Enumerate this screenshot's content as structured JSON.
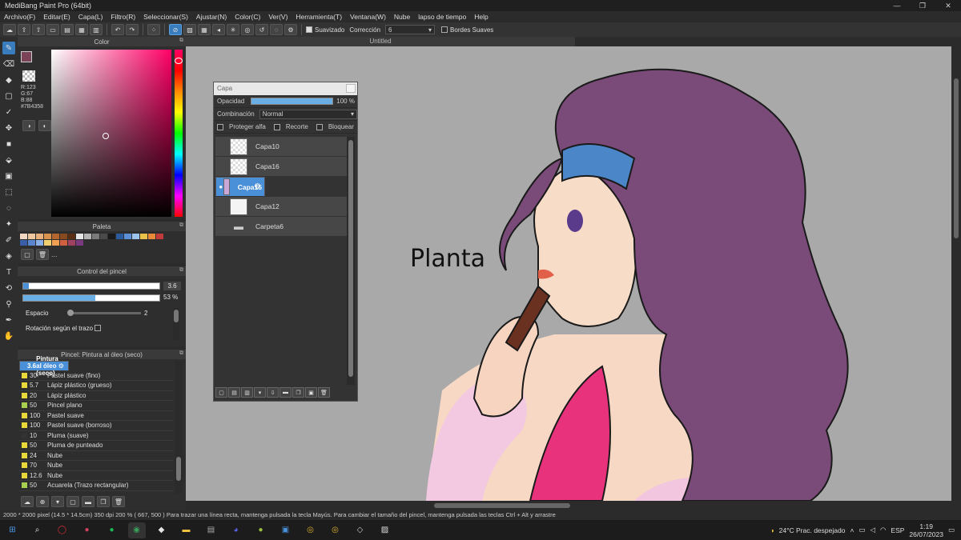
{
  "window": {
    "title": "MediBang Paint Pro (64bit)",
    "min": "—",
    "max": "❐",
    "close": "✕"
  },
  "menu": [
    "Archivo(F)",
    "Editar(E)",
    "Capa(L)",
    "Filtro(R)",
    "Seleccionar(S)",
    "Ajustar(N)",
    "Color(C)",
    "Ver(V)",
    "Herramienta(T)",
    "Ventana(W)",
    "Nube",
    "lapso de tiempo",
    "Help"
  ],
  "toolbar": {
    "suavizado_label": "Suavizado",
    "correccion_label": "Corrección",
    "correccion_value": "6",
    "bordes_label": "Bordes Suaves"
  },
  "document": {
    "tab_title": "Untitled"
  },
  "color_panel": {
    "title": "Color",
    "r": "R:123",
    "g": "G:67",
    "b": "B:88",
    "hex": "#7B4358",
    "primary_color": "#7b4358"
  },
  "palette_panel": {
    "title": "Paleta",
    "more": "...",
    "colors": [
      "#f2d7c4",
      "#f0c8a0",
      "#e8b07a",
      "#d9934e",
      "#b5652e",
      "#8a4a20",
      "#5a2e12",
      "#e6e6e6",
      "#b5b5b5",
      "#7a7a7a",
      "#4a4a4a",
      "#1a1a1a",
      "#2c5a9e",
      "#5b8fd6",
      "#9cc3ec",
      "#e8c24a",
      "#e88a3a",
      "#c23a3a",
      "#3a5ea8",
      "#5a86d0",
      "#8ab0e6",
      "#f0d070",
      "#f0a050",
      "#d06040",
      "#a04060",
      "#7a3a80"
    ]
  },
  "brush_control": {
    "title": "Control del pincel",
    "size_value": "3.6",
    "opacity_value": "53 %",
    "opacity_fraction": 0.53,
    "spacing_label": "Espacio",
    "spacing_value": "2",
    "rotation_label": "Rotación según el trazo"
  },
  "brush_list": {
    "title": "Pincel: Pintura al óleo (seco)",
    "items": [
      {
        "size": "3.6",
        "name": "Pintura al óleo (seco)",
        "selected": true,
        "color": "#a8d050"
      },
      {
        "size": "30",
        "name": "Pastel suave (fino)",
        "color": "#e8d83a"
      },
      {
        "size": "5.7",
        "name": "Lápiz plástico (grueso)",
        "color": "#e8d83a"
      },
      {
        "size": "20",
        "name": "Lápiz plástico",
        "color": "#e8d83a"
      },
      {
        "size": "50",
        "name": "Pincel plano",
        "color": "#a8d050"
      },
      {
        "size": "100",
        "name": "Pastel suave",
        "color": "#e8d83a"
      },
      {
        "size": "100",
        "name": "Pastel suave (borroso)",
        "color": "#e8d83a"
      },
      {
        "size": "10",
        "name": "Pluma (suave)",
        "color": "#333333"
      },
      {
        "size": "50",
        "name": "Pluma de punteado",
        "color": "#e8d83a"
      },
      {
        "size": "24",
        "name": "Nube",
        "color": "#e8d83a"
      },
      {
        "size": "70",
        "name": "Nube",
        "color": "#e8d83a"
      },
      {
        "size": "12.6",
        "name": "Nube",
        "color": "#e8d83a"
      },
      {
        "size": "50",
        "name": "Acuarela (Trazo rectangular)",
        "color": "#a8d050"
      }
    ]
  },
  "layer_panel": {
    "title": "Capa",
    "opacity_label": "Opacidad",
    "opacity_value": "100 %",
    "blend_label": "Combinación",
    "blend_value": "Normal",
    "protect_alpha": "Proteger alfa",
    "clip": "Recorte",
    "lock": "Bloquear",
    "layers": [
      {
        "name": "Capa10",
        "selected": false
      },
      {
        "name": "Capa16",
        "selected": false
      },
      {
        "name": "Capa15",
        "selected": true
      },
      {
        "name": "Capa12",
        "selected": false
      },
      {
        "name": "Carpeta6",
        "folder": true
      }
    ]
  },
  "canvas_text": "Planta",
  "status": {
    "text": "2000 * 2000 pixel   (14.5 * 14.5cm)   350 dpi   200 %   ( 667, 500 )   Para trazar una línea recta, mantenga pulsada la tecla Mayús. Para cambiar el tamaño del pincel, mantenga pulsada las teclas Ctrl + Alt y arrastre"
  },
  "taskbar": {
    "weather": "24°C  Prac. despejado",
    "lang": "ESP",
    "time": "1:19",
    "date": "26/07/2023"
  }
}
